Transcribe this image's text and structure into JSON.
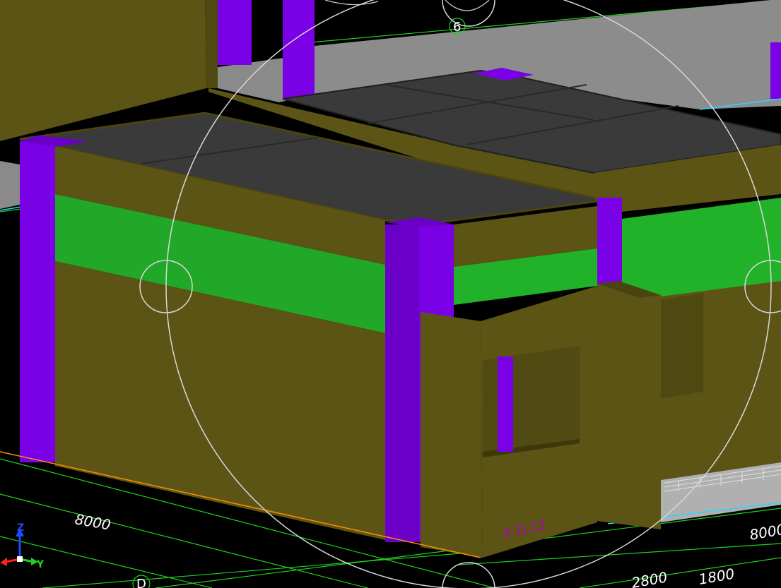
{
  "viewport": {
    "background": "#000000",
    "dimensions": [
      {
        "id": "dim-left",
        "text": "8000"
      },
      {
        "id": "dim-right",
        "text": "8000"
      },
      {
        "id": "dim-bottom-right-1",
        "text": "1800"
      },
      {
        "id": "dim-bottom-right-2",
        "text": "2800"
      }
    ],
    "grid_labels": [
      {
        "id": "grid-bubble-6",
        "text": "6"
      },
      {
        "id": "grid-bubble-d",
        "text": "D"
      }
    ],
    "ucs_axes": {
      "z_label": "Z",
      "y_label": "Y"
    },
    "magenta_label": "3-1L12",
    "colors": {
      "wall": "#5b5414",
      "wall_dark": "#4a4410",
      "slab": "#333333",
      "column": "#7a00e6",
      "beam_band": "#22b22a",
      "gray_wall": "#8a8a8a",
      "grid_line": "#1fd21f",
      "orbit_circle": "#d8d8d8",
      "edge_orange": "#ff8c00",
      "edge_cyan": "#2ad4ff"
    },
    "navigation": {
      "orbit_gizmo": "orbit-circle",
      "handles": [
        "left-handle",
        "right-handle",
        "top-handle",
        "bottom-handle"
      ]
    }
  }
}
